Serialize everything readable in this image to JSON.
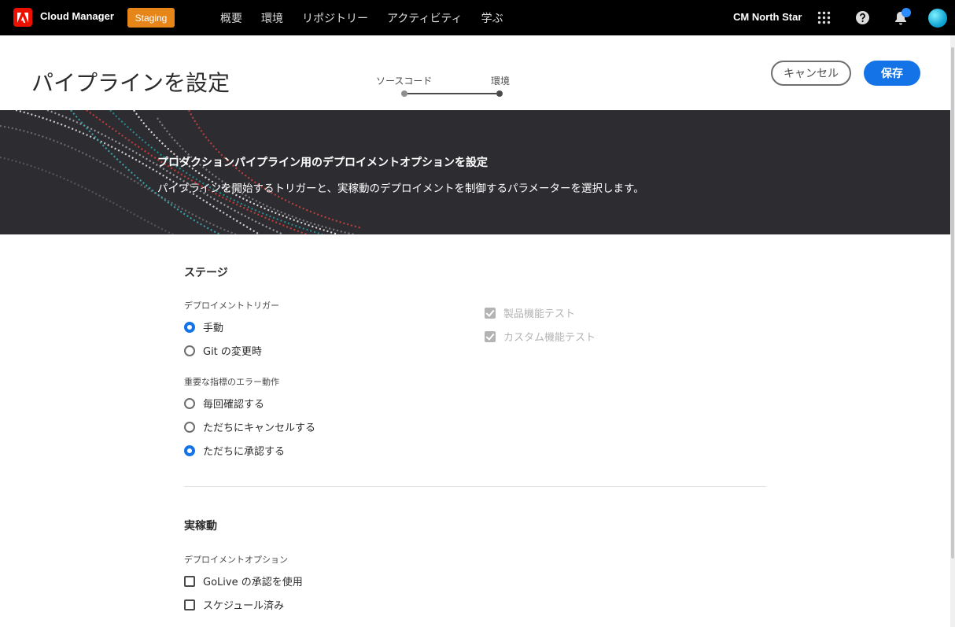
{
  "topnav": {
    "app_title": "Cloud Manager",
    "env_badge": "Staging",
    "links": [
      "概要",
      "環境",
      "リポジトリー",
      "アクティビティ",
      "学ぶ"
    ],
    "org_name": "CM North Star",
    "icons": [
      "adobe-logo-icon",
      "apps-grid-icon",
      "help-icon",
      "bell-icon",
      "avatar"
    ]
  },
  "header": {
    "title": "パイプラインを設定",
    "steps": [
      "ソースコード",
      "環境"
    ],
    "cancel_label": "キャンセル",
    "save_label": "保存"
  },
  "banner": {
    "title": "プロダクションパイプライン用のデプロイメントオプションを設定",
    "subtitle": "パイプラインを開始するトリガーと、実稼動のデプロイメントを制御するパラメーターを選択します。"
  },
  "stage": {
    "title": "ステージ",
    "trigger_label": "デプロイメントトリガー",
    "trigger_options": [
      {
        "label": "手動",
        "checked": true
      },
      {
        "label": "Git の変更時",
        "checked": false
      }
    ],
    "tests": [
      {
        "label": "製品機能テスト",
        "checked": true,
        "disabled": true
      },
      {
        "label": "カスタム機能テスト",
        "checked": true,
        "disabled": true
      }
    ],
    "error_label": "重要な指標のエラー動作",
    "error_options": [
      {
        "label": "毎回確認する",
        "checked": false
      },
      {
        "label": "ただちにキャンセルする",
        "checked": false
      },
      {
        "label": "ただちに承認する",
        "checked": true
      }
    ]
  },
  "production": {
    "title": "実稼動",
    "deploy_label": "デプロイメントオプション",
    "deploy_options": [
      {
        "label": "GoLive の承認を使用",
        "checked": false
      },
      {
        "label": "スケジュール済み",
        "checked": false
      }
    ]
  },
  "colors": {
    "accent": "#1473e6",
    "badge": "#e68619",
    "banner_bg": "#2d2c30",
    "adobe_red": "#eb1000"
  }
}
